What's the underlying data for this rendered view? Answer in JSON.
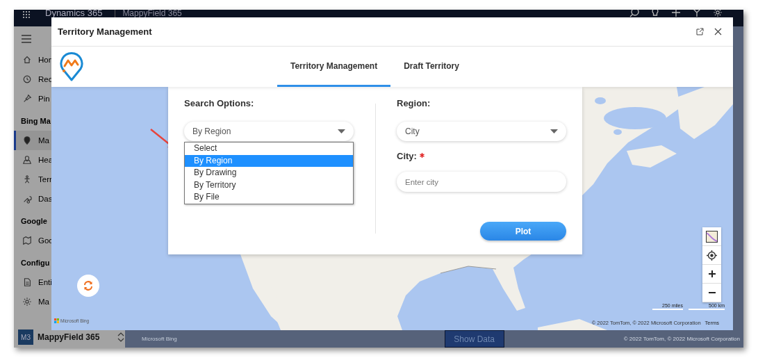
{
  "top_bar": {
    "brand": "Dynamics 365",
    "app_name": "MappyField 365"
  },
  "sidebar": {
    "items": [
      {
        "kind": "item",
        "label": "Hon",
        "selected": false
      },
      {
        "kind": "item",
        "label": "Rec",
        "selected": false
      },
      {
        "kind": "item",
        "label": "Pin",
        "selected": false
      },
      {
        "kind": "heading",
        "label": "Bing Ma"
      },
      {
        "kind": "item",
        "label": "Ma",
        "selected": true
      },
      {
        "kind": "item",
        "label": "Hea",
        "selected": false
      },
      {
        "kind": "item",
        "label": "Terr",
        "selected": false
      },
      {
        "kind": "item",
        "label": "Das",
        "selected": false
      },
      {
        "kind": "heading",
        "label": "Google"
      },
      {
        "kind": "item",
        "label": "Goo",
        "selected": false
      },
      {
        "kind": "heading",
        "label": "Configu"
      },
      {
        "kind": "item",
        "label": "Enti",
        "selected": false
      },
      {
        "kind": "item",
        "label": "Ma",
        "selected": false
      }
    ]
  },
  "app_switcher": {
    "badge": "M3",
    "name": "MappyField 365"
  },
  "background_page": {
    "show_data_button": "Show Data",
    "map_credit": "Microsoft Bing",
    "copyright": "© 2022 TomTom, © 2022 Microsoft Corporation"
  },
  "dialog": {
    "title": "Territory Management",
    "tabs": [
      {
        "label": "Territory Management",
        "selected": true
      },
      {
        "label": "Draft Territory",
        "selected": false
      }
    ],
    "search_panel": {
      "search_options_label": "Search Options:",
      "search_select": {
        "value": "By Region",
        "expanded": true,
        "options": [
          {
            "label": "Select",
            "selected": false
          },
          {
            "label": "By Region",
            "selected": true
          },
          {
            "label": "By Drawing",
            "selected": false
          },
          {
            "label": "By Territory",
            "selected": false
          },
          {
            "label": "By File",
            "selected": false
          }
        ]
      },
      "region_label": "Region:",
      "region_select": {
        "value": "City"
      },
      "city_label": "City:",
      "city_required": true,
      "city_input": {
        "placeholder": "Enter city"
      },
      "plot_button": "Plot"
    },
    "map": {
      "scale": [
        "250 miles",
        "500 km"
      ],
      "copyright": "© 2022 TomTom, © 2022 Microsoft Corporation",
      "terms": "Terms",
      "credit": "Microsoft Bing"
    }
  }
}
